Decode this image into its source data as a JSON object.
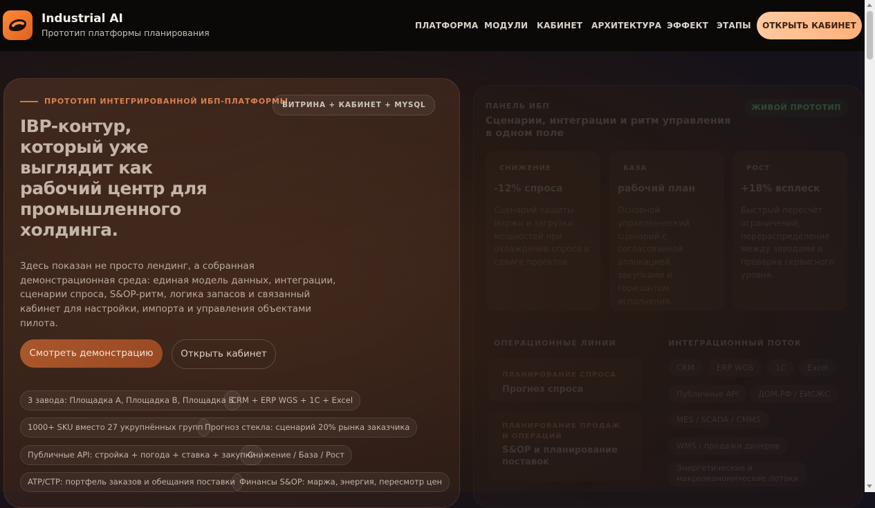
{
  "header": {
    "brand_title": "Industrial AI",
    "brand_subtitle": "Прототип платформы планирования",
    "nav": [
      "ПЛАТФОРМА",
      "МОДУЛИ",
      "КАБИНЕТ",
      "АРХИТЕКТУРА",
      "ЭФФЕКТ",
      "ЭТАПЫ"
    ],
    "cta": "ОТКРЫТЬ КАБИНЕТ"
  },
  "hero": {
    "eyebrow": "ПРОТОТИП ИНТЕГРИРОВАННОЙ ИБП-ПЛАТФОРМЫ",
    "eyebrow_chip": "ВИТРИНА + КАБИНЕТ + MYSQL",
    "headline": [
      "IBP-контур,",
      "который уже",
      "выглядит как",
      "рабочий центр для",
      "промышленного",
      "холдинга."
    ],
    "lead": "Здесь показан не просто лендинг, а собранная демонстрационная среда: единая модель данных, интеграции, сценарии спроса, S&OP-ритм, логика запасов и связанный кабинет для настройки, импорта и управления объектами пилота.",
    "primary_button": "Смотреть демонстрацию",
    "secondary_button": "Открыть кабинет",
    "tags": [
      "3 завода: Площадка А, Площадка В, Площадка Б",
      "CRM + ERP WGS + 1С + Excel",
      "1000+ SKU вместо 27 укрупнённых групп",
      "Прогноз стекла: сценарий 20% рынка заказчика",
      "Публичные API: стройка + погода + ставка + закупки",
      "Снижение / База / Рост",
      "ATP/CTP: портфель заказов и обещания поставки",
      "Финансы S&OP: маржа, энергия, пересмотр цен"
    ]
  },
  "panel": {
    "kicker": "ПАНЕЛЬ ИБП",
    "title": "Сценарии, интеграции и ритм управления в одном поле",
    "badge": "ЖИВОЙ ПРОТОТИП",
    "scenarios": [
      {
        "kicker": "СНИЖЕНИЕ",
        "title": "-12% спроса",
        "desc": "Сценарий защиты маржи и загрузки мощностей при охлаждении спроса и сдвиге проектов."
      },
      {
        "kicker": "БАЗА",
        "title": "рабочий план",
        "desc": "Основной управленческий сценарий с согласованной аллокацией, закупками и горизонтом исполнения."
      },
      {
        "kicker": "РОСТ",
        "title": "+18% всплеск",
        "desc": "Быстрый пересчёт ограничений, перераспределение между заводами и проверка сервисного уровня."
      }
    ],
    "ops_kicker": "ОПЕРАЦИОННЫЕ ЛИНИИ",
    "ops": [
      {
        "kicker": "ПЛАНИРОВАНИЕ СПРОСА",
        "title": "Прогноз спроса"
      },
      {
        "kicker": "ПЛАНИРОВАНИЕ ПРОДАЖ И ОПЕРАЦИЙ",
        "title": "S&OP и планирование поставок"
      }
    ],
    "integrations_kicker": "ИНТЕГРАЦИОННЫЙ ПОТОК",
    "integrations": [
      "CRM",
      "ERP WGS",
      "1С",
      "Excel",
      "Публичные API",
      "ДОМ.РФ / ЕИСЖС",
      "MES / SCADA / CMMS",
      "WMS / продажи дилеров",
      "Энергетические и",
      "макроэкономические потоки"
    ]
  }
}
